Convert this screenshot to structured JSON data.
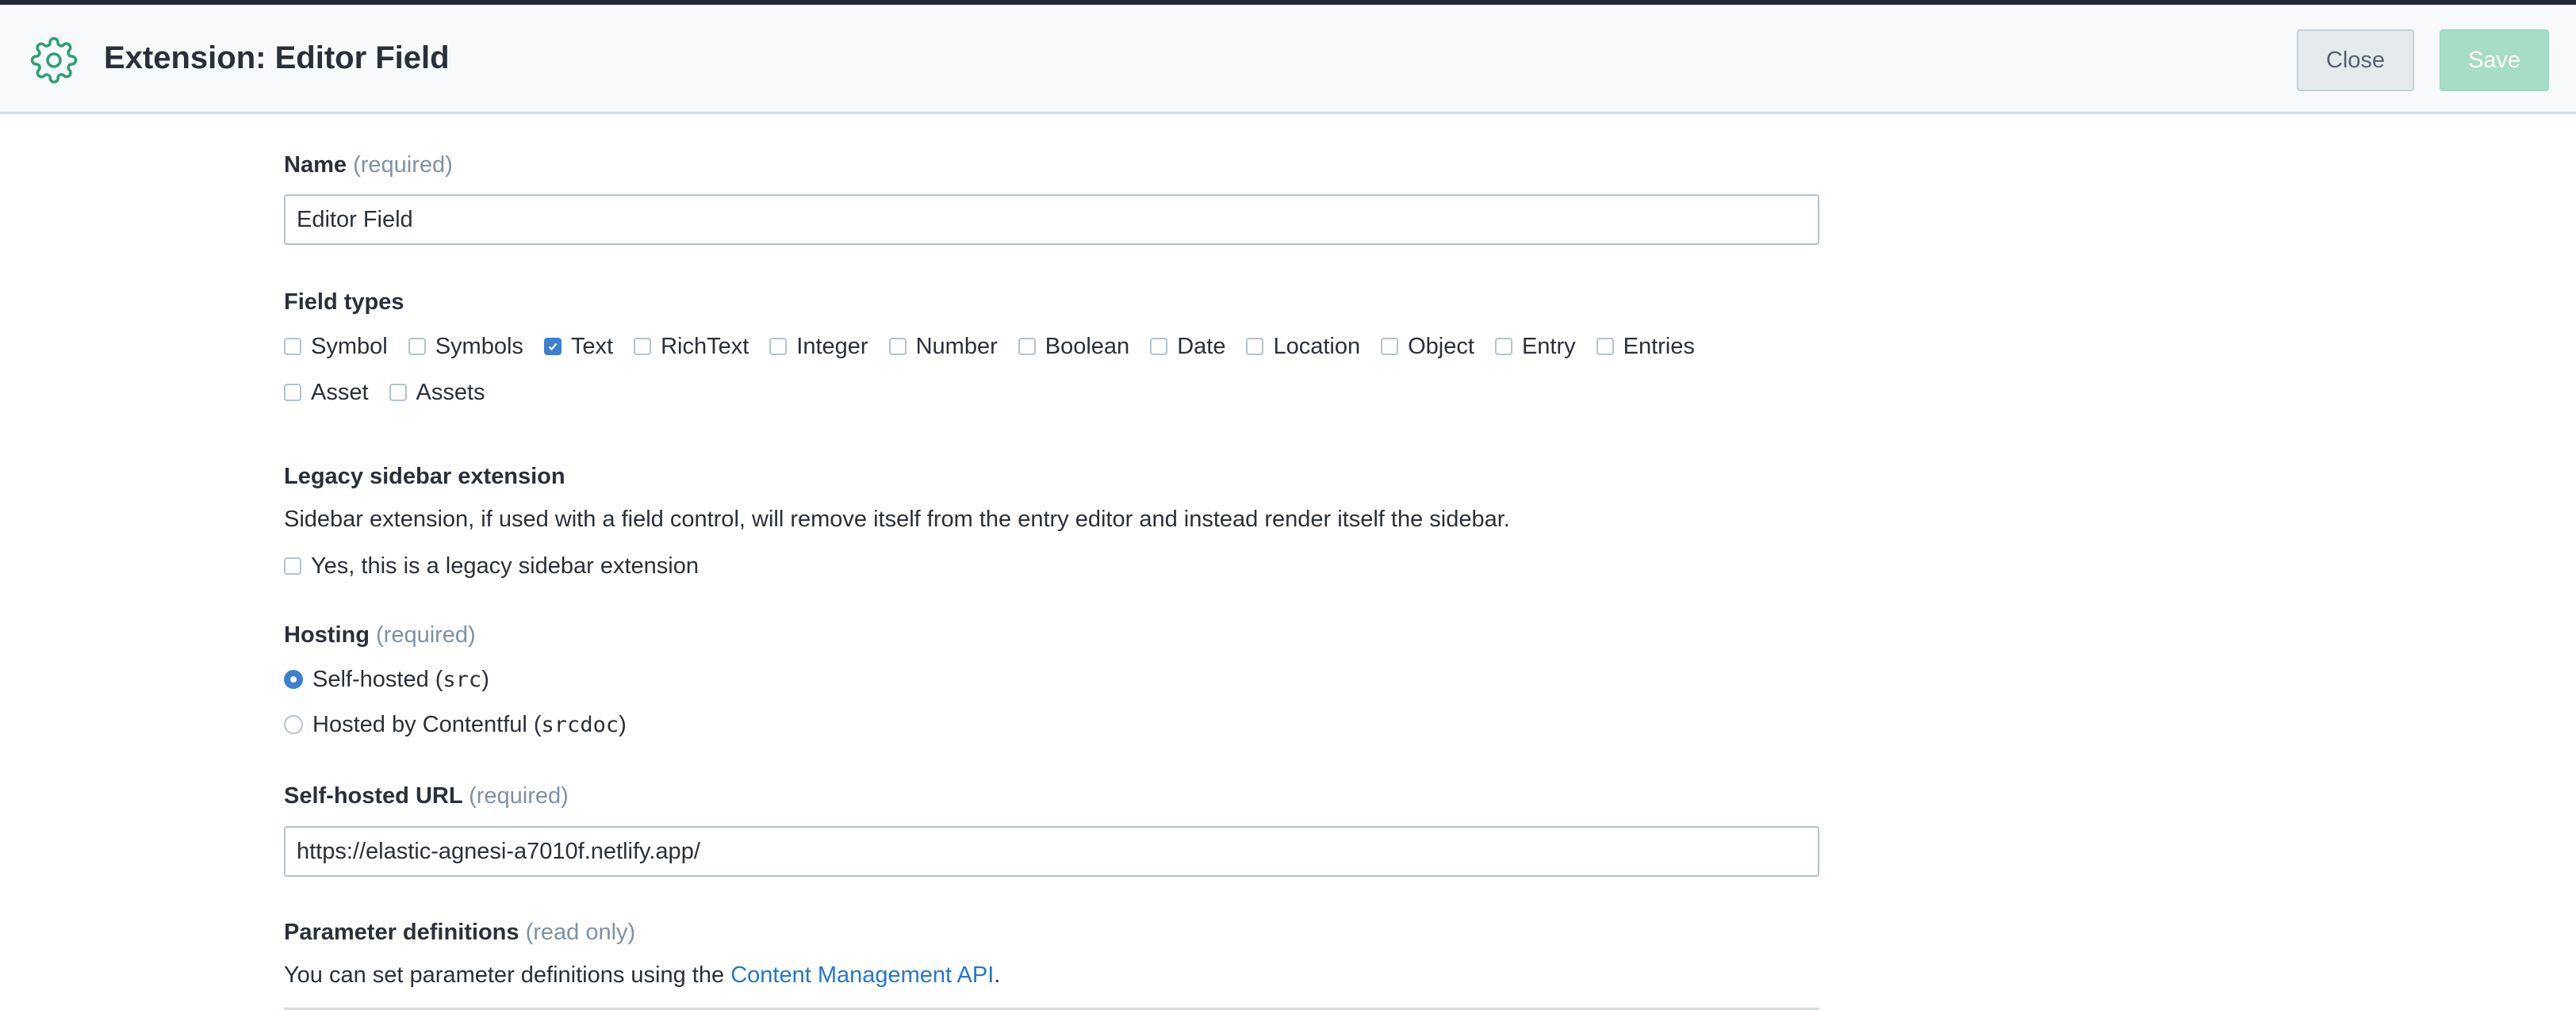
{
  "header": {
    "title": "Extension: Editor Field",
    "close_label": "Close",
    "save_label": "Save",
    "icon": "gear-icon",
    "accent": "#2e9f73"
  },
  "name_field": {
    "label": "Name",
    "hint": "(required)",
    "value": "Editor Field"
  },
  "field_types": {
    "label": "Field types",
    "row1": [
      {
        "label": "Symbol",
        "checked": false
      },
      {
        "label": "Symbols",
        "checked": false
      },
      {
        "label": "Text",
        "checked": true
      },
      {
        "label": "RichText",
        "checked": false
      },
      {
        "label": "Integer",
        "checked": false
      },
      {
        "label": "Number",
        "checked": false
      },
      {
        "label": "Boolean",
        "checked": false
      },
      {
        "label": "Date",
        "checked": false
      },
      {
        "label": "Location",
        "checked": false
      },
      {
        "label": "Object",
        "checked": false
      },
      {
        "label": "Entry",
        "checked": false
      },
      {
        "label": "Entries",
        "checked": false
      }
    ],
    "row2": [
      {
        "label": "Asset",
        "checked": false
      },
      {
        "label": "Assets",
        "checked": false
      }
    ]
  },
  "legacy_sidebar": {
    "label": "Legacy sidebar extension",
    "description": "Sidebar extension, if used with a field control, will remove itself from the entry editor and instead render itself the sidebar.",
    "checkbox_label": "Yes, this is a legacy sidebar extension",
    "checked": false
  },
  "hosting": {
    "label": "Hosting",
    "hint": "(required)",
    "options": [
      {
        "text": "Self-hosted (",
        "code": "src",
        "suffix": ")",
        "selected": true
      },
      {
        "text": "Hosted by Contentful (",
        "code": "srcdoc",
        "suffix": ")",
        "selected": false
      }
    ]
  },
  "self_hosted_url": {
    "label": "Self-hosted URL",
    "hint": "(required)",
    "value": "https://elastic-agnesi-a7010f.netlify.app/"
  },
  "parameter_definitions": {
    "label": "Parameter definitions",
    "hint": "(read only)",
    "text": "You can set parameter definitions using the",
    "link": "Content Management API",
    "after_link": "."
  }
}
